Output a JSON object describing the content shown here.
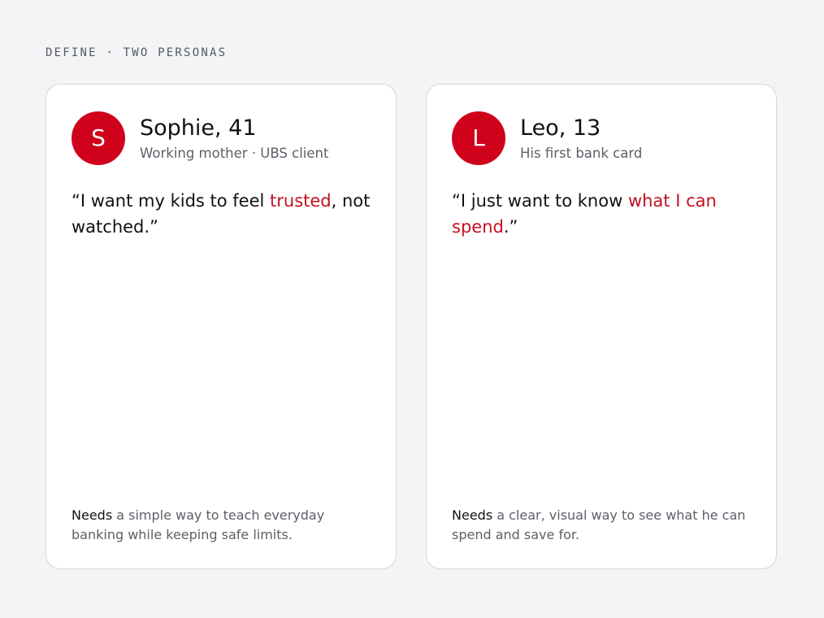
{
  "header": {
    "eyebrow": "DEFINE · TWO PERSONAS"
  },
  "personas": [
    {
      "initial": "S",
      "name": "Sophie, 41",
      "role": "Working mother · UBS client",
      "quote": {
        "before": "“I want my kids to feel ",
        "highlight": "trusted",
        "after": ", not watched.”"
      },
      "needs_label": "Needs",
      "needs_text": " a simple way to teach everyday banking while keeping safe limits."
    },
    {
      "initial": "L",
      "name": "Leo, 13",
      "role": "His first bank card",
      "quote": {
        "before": "“I just want to know ",
        "highlight": "what I can spend",
        "after": ".”"
      },
      "needs_label": "Needs",
      "needs_text": " a clear, visual way to see what he can spend and save for."
    }
  ],
  "colors": {
    "accent": "#d0021b",
    "highlight_text": "#c1121f",
    "background": "#f3f4f6",
    "card": "#ffffff"
  }
}
